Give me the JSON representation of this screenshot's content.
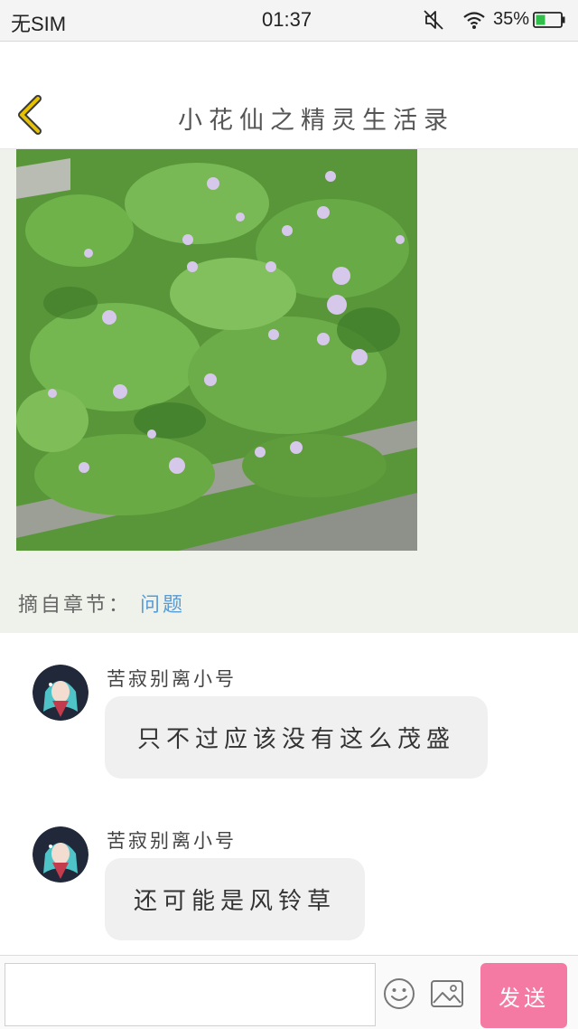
{
  "status_bar": {
    "carrier": "无SIM",
    "time": "01:37",
    "battery": "35%",
    "icons": [
      "mute-icon",
      "wifi-icon",
      "battery-icon"
    ]
  },
  "header": {
    "title": "小花仙之精灵生活录",
    "back_icon": "chevron-left-icon",
    "accent_color": "#e7c200"
  },
  "excerpt": {
    "photo_subject": "flower-photo",
    "source_label": "摘自章节：",
    "source_link": "问题",
    "background": "#eef2ea"
  },
  "comments": [
    {
      "username": "苦寂别离小号",
      "message": "只不过应该没有这么茂盛"
    },
    {
      "username": "苦寂别离小号",
      "message": "还可能是风铃草"
    }
  ],
  "input_bar": {
    "placeholder": "",
    "value": "",
    "emoji_icon": "smiley-icon",
    "image_icon": "image-icon",
    "send_label": "发送",
    "send_color": "#f57aa3"
  }
}
